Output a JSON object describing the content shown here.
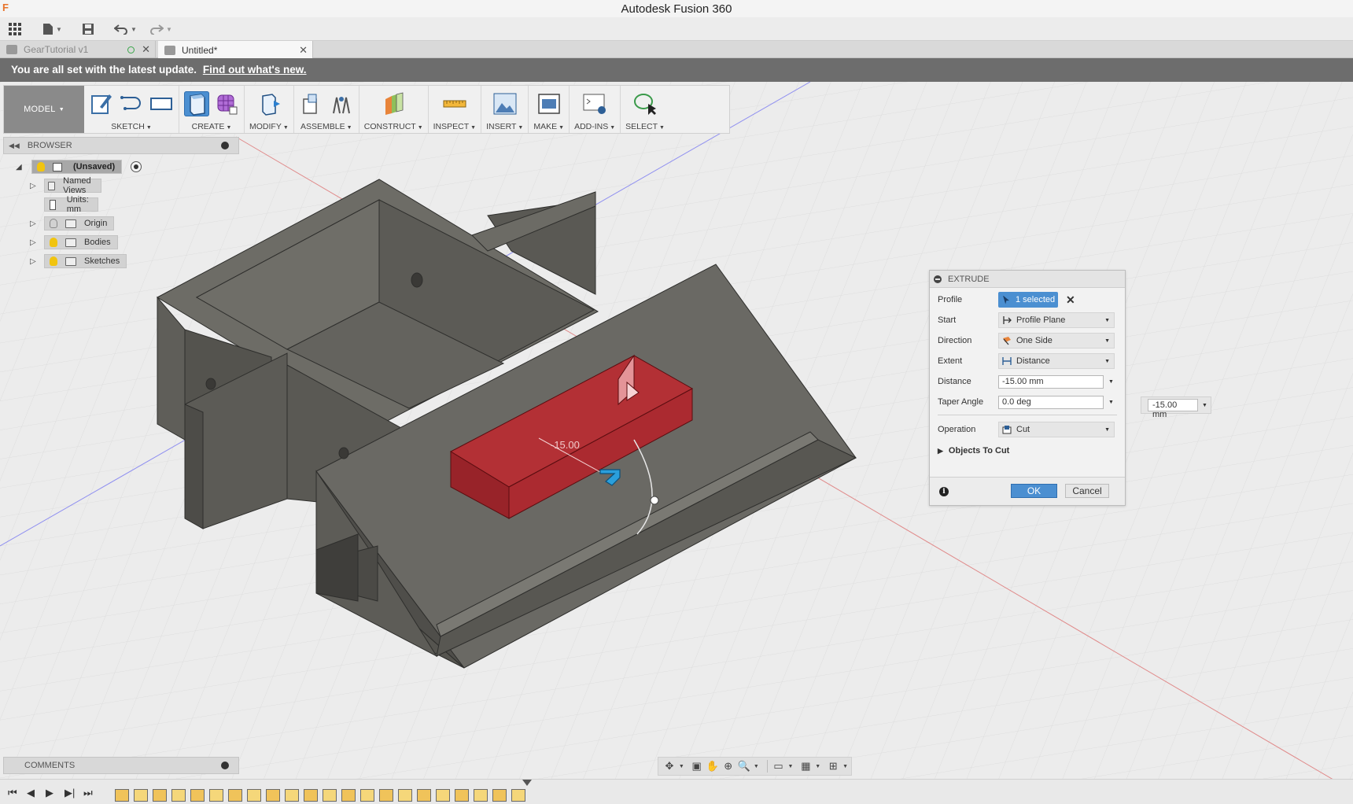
{
  "app": {
    "title": "Autodesk Fusion 360",
    "logo": "F"
  },
  "tabs": [
    {
      "label": "GearTutorial v1",
      "active": false
    },
    {
      "label": "Untitled*",
      "active": true
    }
  ],
  "notice": {
    "text": "You are all set with the latest update.",
    "link": "Find out what's new."
  },
  "ribbon": {
    "workspace": "MODEL",
    "groups": [
      {
        "label": "SKETCH",
        "icons": [
          "sketch-create-icon",
          "line-icon",
          "rectangle-icon"
        ]
      },
      {
        "label": "CREATE",
        "icons": [
          "extrude-icon",
          "form-icon"
        ]
      },
      {
        "label": "MODIFY",
        "icons": [
          "press-pull-icon"
        ]
      },
      {
        "label": "ASSEMBLE",
        "icons": [
          "new-component-icon",
          "joint-icon"
        ]
      },
      {
        "label": "CONSTRUCT",
        "icons": [
          "offset-plane-icon"
        ]
      },
      {
        "label": "INSPECT",
        "icons": [
          "measure-icon"
        ]
      },
      {
        "label": "INSERT",
        "icons": [
          "insert-image-icon"
        ]
      },
      {
        "label": "MAKE",
        "icons": [
          "print-3d-icon"
        ]
      },
      {
        "label": "ADD-INS",
        "icons": [
          "scripts-icon"
        ]
      },
      {
        "label": "SELECT",
        "icons": [
          "select-icon"
        ]
      }
    ]
  },
  "browser": {
    "title": "BROWSER",
    "root": "(Unsaved)",
    "items": [
      {
        "label": "Named Views"
      },
      {
        "label": "Units: mm"
      },
      {
        "label": "Origin"
      },
      {
        "label": "Bodies"
      },
      {
        "label": "Sketches"
      }
    ]
  },
  "extrude": {
    "title": "EXTRUDE",
    "rows": {
      "profile": {
        "label": "Profile",
        "value": "1 selected"
      },
      "start": {
        "label": "Start",
        "value": "Profile Plane"
      },
      "direction": {
        "label": "Direction",
        "value": "One Side"
      },
      "extent": {
        "label": "Extent",
        "value": "Distance"
      },
      "distance": {
        "label": "Distance",
        "value": "-15.00 mm"
      },
      "taper": {
        "label": "Taper Angle",
        "value": "0.0 deg"
      },
      "operation": {
        "label": "Operation",
        "value": "Cut"
      }
    },
    "objects_to_cut": "Objects To Cut",
    "ok": "OK",
    "cancel": "Cancel"
  },
  "viewport": {
    "distance_label": "-15.00",
    "float_input": "-15.00 mm"
  },
  "comments": {
    "title": "COMMENTS"
  },
  "colors": {
    "accent": "#4b8fd1",
    "cut_preview": "#c0272d",
    "body": "#676660"
  }
}
